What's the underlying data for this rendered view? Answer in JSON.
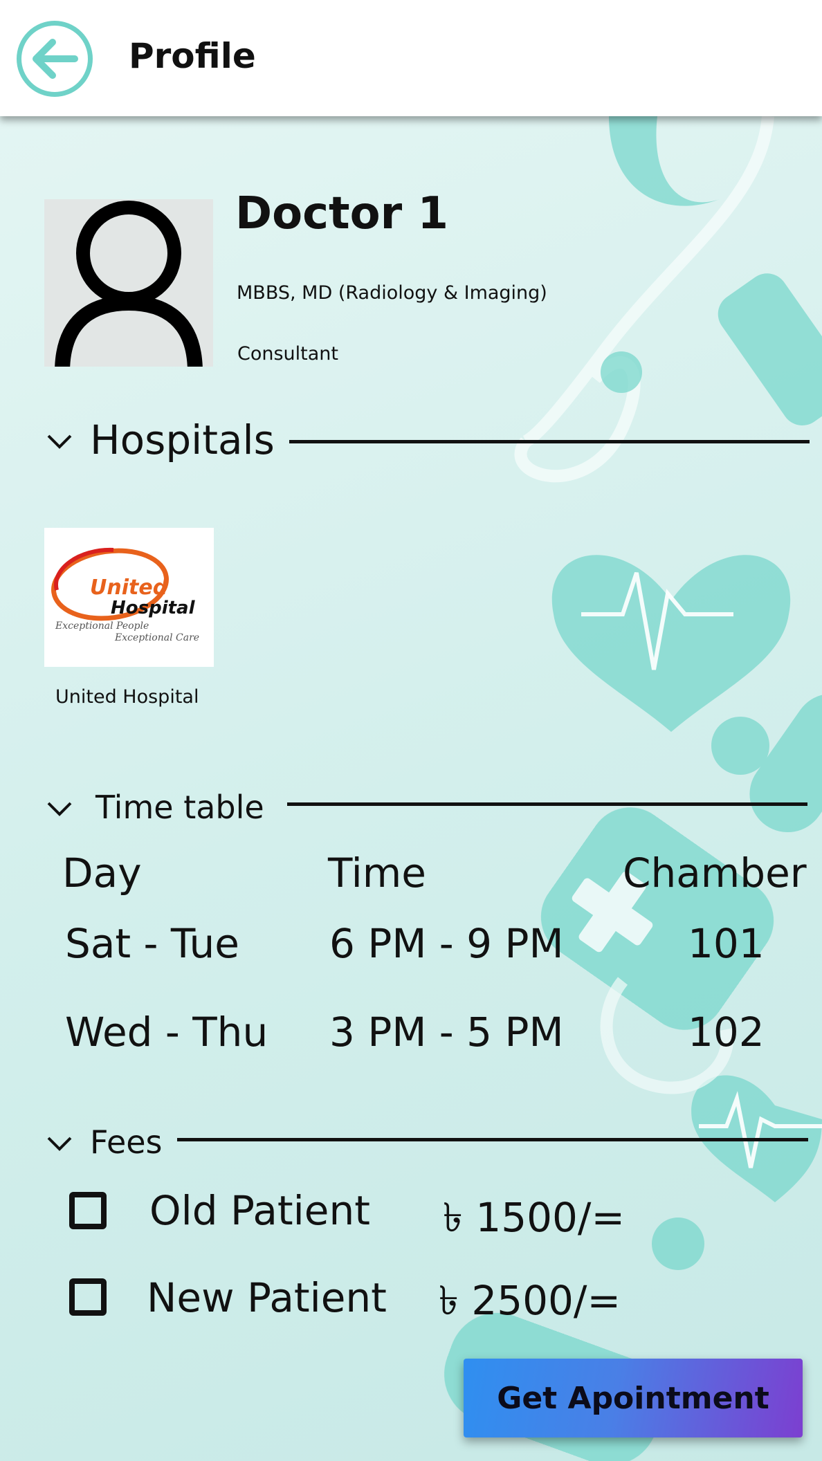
{
  "header": {
    "title": "Profile"
  },
  "doctor": {
    "name": "Doctor 1",
    "degree": "MBBS, MD (Radiology & Imaging)",
    "role": "Consultant"
  },
  "hospitals": {
    "heading": "Hospitals",
    "items": [
      {
        "name": "United Hospital",
        "logo_word1": "United",
        "logo_word2": "Hospital",
        "logo_tag1": "Exceptional People",
        "logo_tag2": "Exceptional Care"
      }
    ]
  },
  "timetable": {
    "heading": "Time table",
    "columns": [
      "Day",
      "Time",
      "Chamber"
    ],
    "rows": [
      {
        "day": "Sat - Tue",
        "time": "6 PM - 9 PM",
        "chamber": "101"
      },
      {
        "day": "Wed - Thu",
        "time": "3 PM - 5 PM",
        "chamber": "102"
      }
    ]
  },
  "fees": {
    "heading": "Fees",
    "items": [
      {
        "label": "Old Patient",
        "value": "৳ 1500/=",
        "checked": false
      },
      {
        "label": "New Patient",
        "value": "৳ 2500/=",
        "checked": false
      }
    ]
  },
  "cta": {
    "label": "Get Apointment"
  },
  "colors": {
    "accent": "#6fd2c8",
    "background": "#d6efed",
    "cta_start": "#2f8ff0",
    "cta_end": "#7c3fd0",
    "logo_orange": "#e8621c",
    "logo_red": "#d9201e"
  }
}
